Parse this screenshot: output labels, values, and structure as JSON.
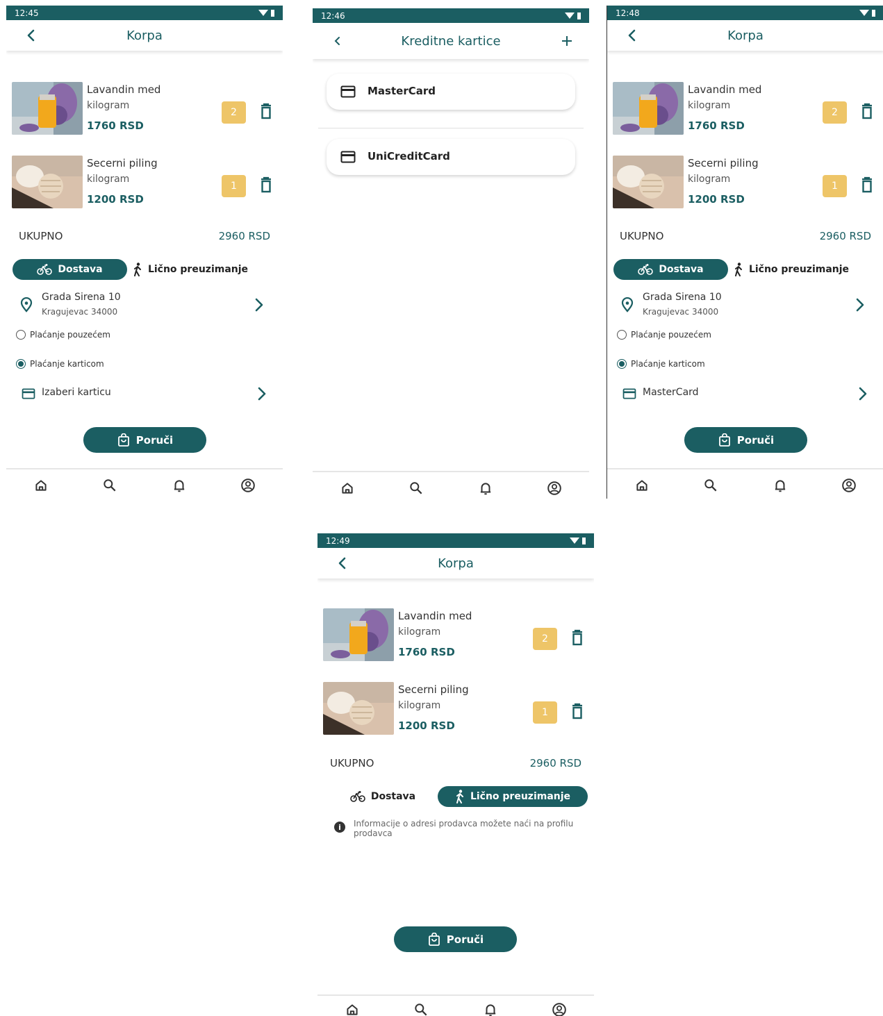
{
  "colors": {
    "primary": "#1b5e62",
    "qty_badge": "#eec568",
    "statusbar": "#1b5e62"
  },
  "cart_items": [
    {
      "name": "Lavandin med",
      "unit": "kilogram",
      "price": "1760 RSD",
      "qty": "2"
    },
    {
      "name": "Secerni piling",
      "unit": "kilogram",
      "price": "1200 RSD",
      "qty": "1"
    }
  ],
  "screen1": {
    "time": "12:45",
    "title": "Korpa",
    "total_label": "UKUPNO",
    "total_value": "2960 RSD",
    "delivery_label": "Dostava",
    "pickup_label": "Lično preuzimanje",
    "address_line1": "Grada Sirena 10",
    "address_line2": "Kragujevac 34000",
    "pay_cash": "Plaćanje pouzećem",
    "pay_card": "Plaćanje karticom",
    "card_select": "Izaberi karticu",
    "order_btn": "Poruči"
  },
  "screen2": {
    "time": "12:46",
    "title": "Kreditne kartice",
    "cards": [
      "MasterCard",
      "UniCreditCard"
    ]
  },
  "screen3": {
    "time": "12:48",
    "title": "Korpa",
    "total_label": "UKUPNO",
    "total_value": "2960 RSD",
    "delivery_label": "Dostava",
    "pickup_label": "Lično preuzimanje",
    "address_line1": "Grada Sirena 10",
    "address_line2": "Kragujevac 34000",
    "pay_cash": "Plaćanje pouzećem",
    "pay_card": "Plaćanje karticom",
    "card_select": "MasterCard",
    "order_btn": "Poruči"
  },
  "screen4": {
    "time": "12:49",
    "title": "Korpa",
    "total_label": "UKUPNO",
    "total_value": "2960 RSD",
    "delivery_label": "Dostava",
    "pickup_label": "Lično preuzimanje",
    "info_text": "Informacije o adresi prodavca možete naći na profilu prodavca",
    "order_btn": "Poruči"
  },
  "nav_icons": [
    "home-icon",
    "search-icon",
    "bell-icon",
    "account-icon"
  ]
}
